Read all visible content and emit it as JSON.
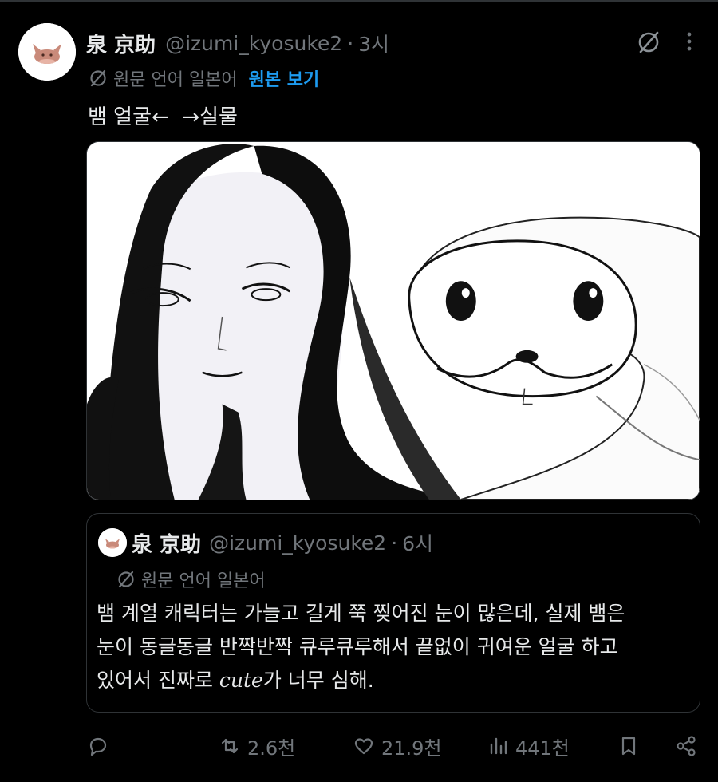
{
  "tweet": {
    "display_name": "泉 京助",
    "handle": "@izumi_kyosuke2",
    "separator": "·",
    "time": "3시",
    "translated_from": "원문 언어 일본어",
    "show_original": "원본 보기",
    "text": "뱀 얼굴←  →실물"
  },
  "quote": {
    "display_name": "泉 京助",
    "handle": "@izumi_kyosuke2",
    "separator": "·",
    "time": "6시",
    "translated_from": "원문 언어 일본어",
    "line1": "뱀 계열 캐릭터는 가늘고 길게 쭉 찢어진 눈이 많은데, 실제 뱀은",
    "line2": "눈이 동글동글 반짝반짝 큐루큐루해서 끝없이 귀여운 얼굴 하고",
    "line3_before": "있어서 진짜로 ",
    "line3_em": "cute",
    "line3_after": "가 너무 심해."
  },
  "actions": {
    "retweets": "2.6천",
    "likes": "21.9천",
    "views": "441천"
  },
  "icons": {
    "avatar": "cat-avatar-icon",
    "grok": "grok-icon",
    "more": "more-icon",
    "translate": "translate-icon",
    "reply": "reply-icon",
    "retweet": "retweet-icon",
    "like": "heart-icon",
    "views": "views-icon",
    "bookmark": "bookmark-icon",
    "share": "share-icon"
  },
  "colors": {
    "background": "#000000",
    "text": "#e7e9ea",
    "secondary": "#71767b",
    "link": "#1d9bf0",
    "border": "#2f3336"
  }
}
